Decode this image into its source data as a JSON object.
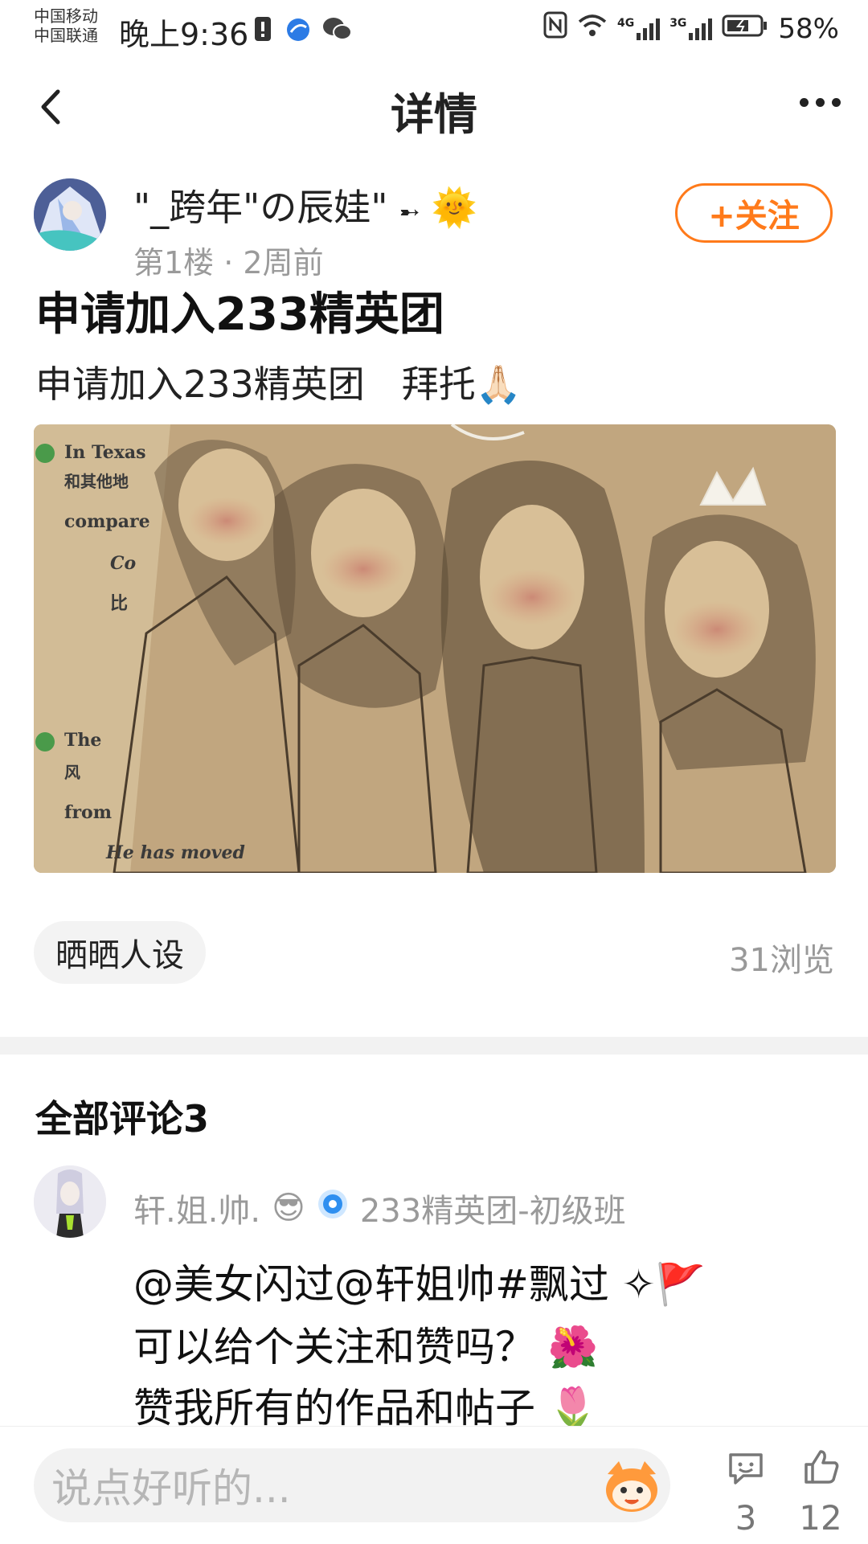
{
  "status_bar": {
    "carrier_1": "中国移动",
    "carrier_2": "中国联通",
    "time": "晚上9:36",
    "net_4g": "4G",
    "net_3g": "3G",
    "battery": "58%"
  },
  "header": {
    "title": "详情"
  },
  "post": {
    "author_name": "\"_跨年\"の辰娃\"",
    "author_emoji": "🌞",
    "floor_meta": "第1楼 · 2周前",
    "follow_label": "+关注",
    "title": "申请加入233精英团",
    "body_text": "申请加入233精英团　拜托",
    "body_emoji": "🙏🏻",
    "tag": "晒晒人设",
    "views": "31浏览"
  },
  "comments": {
    "title": "全部评论3",
    "items": [
      {
        "name": "轩.姐.帅.",
        "name_emoji": "😎",
        "group_label": "233精英团-初级班",
        "lines": [
          "@美女闪过@轩姐帅#飘过 ✧🚩",
          "可以给个关注和赞吗？ 🌺",
          "赞我所有的作品和帖子 🌷"
        ]
      }
    ]
  },
  "bottom_bar": {
    "input_placeholder": "说点好听的...",
    "comment_count": "3",
    "like_count": "12"
  },
  "colors": {
    "accent": "#ff7a1a",
    "muted": "#9a9a9a",
    "divider": "#f2f2f2"
  }
}
